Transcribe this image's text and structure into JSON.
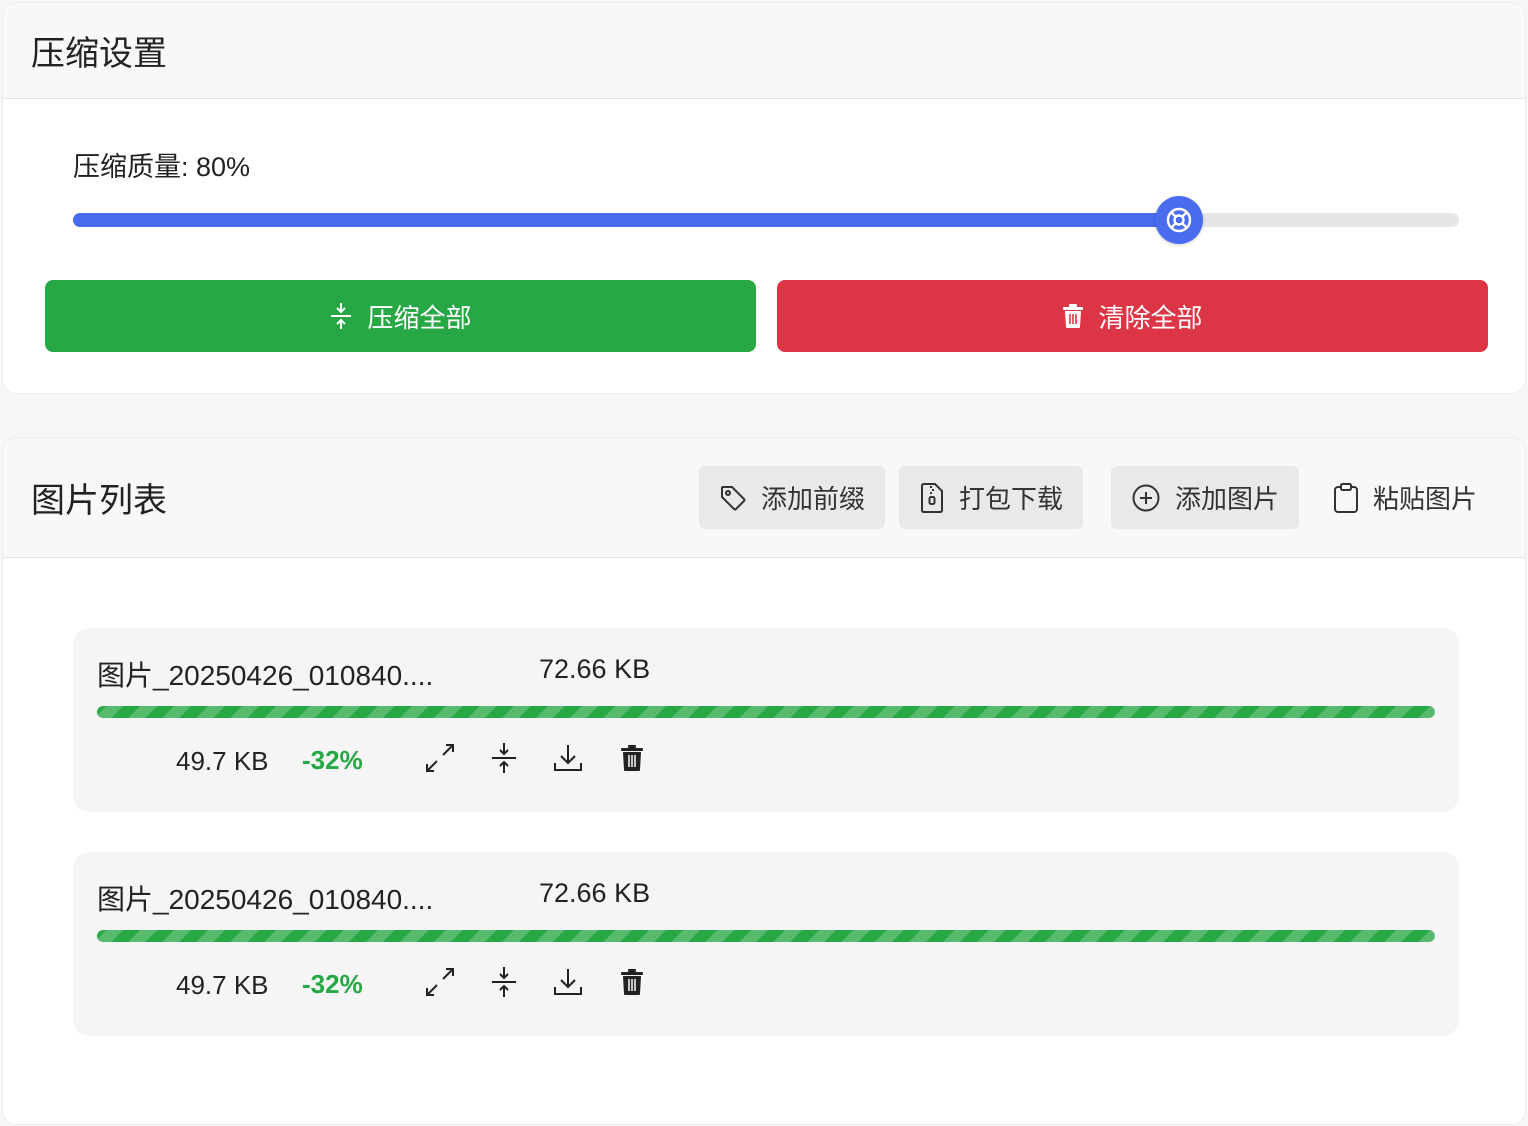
{
  "settings": {
    "title": "压缩设置",
    "quality_label": "压缩质量: 80%",
    "quality_value": 80,
    "compress_all_label": "压缩全部",
    "clear_all_label": "清除全部",
    "colors": {
      "accent": "#4a6cf0",
      "success": "#28a745",
      "danger": "#dc3545"
    }
  },
  "image_list": {
    "title": "图片列表",
    "actions": [
      {
        "label": "添加前缀",
        "icon": "tag-icon"
      },
      {
        "label": "打包下载",
        "icon": "zip-file-icon"
      },
      {
        "label": "添加图片",
        "icon": "plus-circle-icon"
      },
      {
        "label": "粘贴图片",
        "icon": "clipboard-icon"
      }
    ],
    "items": [
      {
        "name": "图片_20250426_010840....",
        "original_size": "72.66 KB",
        "compressed_size": "49.7 KB",
        "ratio": "-32%",
        "progress": 100
      },
      {
        "name": "图片_20250426_010840....",
        "original_size": "72.66 KB",
        "compressed_size": "49.7 KB",
        "ratio": "-32%",
        "progress": 100
      }
    ],
    "item_actions": [
      "expand-icon",
      "compress-icon",
      "download-icon",
      "trash-icon"
    ]
  }
}
